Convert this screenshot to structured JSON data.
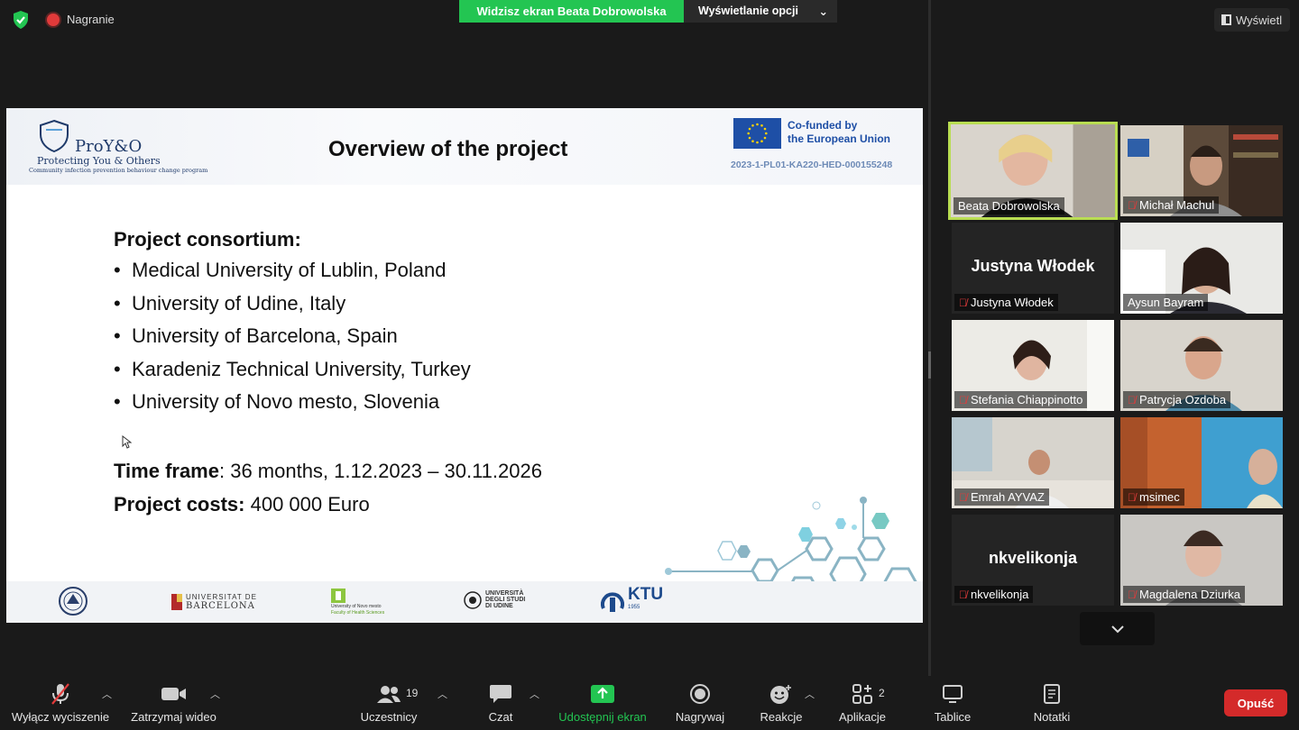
{
  "top": {
    "recording_label": "Nagranie",
    "share_banner": "Widzisz ekran Beata Dobrowolska",
    "view_options": "Wyświetlanie opcji",
    "view_button": "Wyświetl"
  },
  "slide": {
    "logo_title": "ProY&O",
    "logo_subtitle": "Protecting You & Others",
    "logo_tagline": "Community infection prevention behaviour change program",
    "title": "Overview of the project",
    "eu_line1": "Co-funded by",
    "eu_line2": "the European Union",
    "project_code": "2023-1-PL01-KA220-HED-000155248",
    "consortium_heading": "Project consortium:",
    "consortium": [
      "Medical University of Lublin, Poland",
      "University of Udine, Italy",
      "University of Barcelona, Spain",
      "Karadeniz Technical University, Turkey",
      "University of Novo mesto, Slovenia"
    ],
    "timeframe_label": "Time frame",
    "timeframe_value": ": 36 months, 1.12.2023 – 30.11.2026",
    "costs_label": "Project costs:",
    "costs_value": " 400 000 Euro",
    "footer": {
      "barcelona_top": "UNIVERSITAT DE",
      "barcelona_bottom": "BARCELONA",
      "novo_mesto_top": "University of Novo mesto",
      "novo_mesto_bottom": "Faculty of Health Sciences",
      "udine_1": "UNIVERSITÀ",
      "udine_2": "DEGLI STUDI",
      "udine_3": "DI UDINE",
      "ktu": "KTU",
      "ktu_year": "1955"
    }
  },
  "participants": [
    {
      "name": "Beata Dobrowolska",
      "muted": false,
      "video": true,
      "active": true
    },
    {
      "name": "Michał Machul",
      "muted": true,
      "video": true,
      "active": false
    },
    {
      "name": "Justyna Włodek",
      "muted": true,
      "video": false,
      "active": false
    },
    {
      "name": "Aysun Bayram",
      "muted": false,
      "video": true,
      "active": false
    },
    {
      "name": "Stefania Chiappinotto",
      "muted": true,
      "video": true,
      "active": false
    },
    {
      "name": "Patrycja Ozdoba",
      "muted": true,
      "video": true,
      "active": false
    },
    {
      "name": "Emrah AYVAZ",
      "muted": true,
      "video": true,
      "active": false
    },
    {
      "name": "msimec",
      "muted": true,
      "video": true,
      "active": false
    },
    {
      "name": "nkvelikonja",
      "muted": true,
      "video": false,
      "active": false
    },
    {
      "name": "Magdalena Dziurka",
      "muted": true,
      "video": true,
      "active": false
    }
  ],
  "toolbar": {
    "unmute": "Wyłącz wyciszenie",
    "stop_video": "Zatrzymaj wideo",
    "participants": "Uczestnicy",
    "participants_count": "19",
    "chat": "Czat",
    "share": "Udostępnij ekran",
    "record": "Nagrywaj",
    "reactions": "Reakcje",
    "apps": "Aplikacje",
    "apps_count": "2",
    "whiteboards": "Tablice",
    "notes": "Notatki",
    "leave": "Opuść"
  },
  "colors": {
    "share_green": "#23c552",
    "leave_red": "#d42a2a",
    "active_border": "#b9dd52",
    "mute_red": "#e23b3b"
  }
}
